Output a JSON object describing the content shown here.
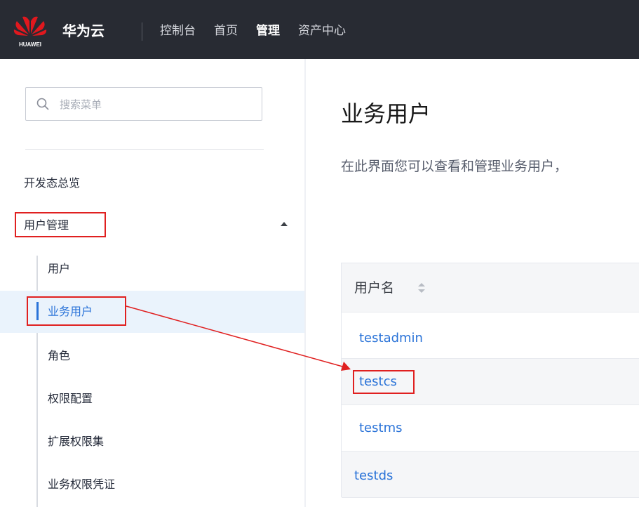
{
  "topbar": {
    "brand": "华为云",
    "logo_text": "HUAWEI",
    "nav": [
      {
        "label": "控制台",
        "active": false
      },
      {
        "label": "首页",
        "active": false
      },
      {
        "label": "管理",
        "active": true
      },
      {
        "label": "资产中心",
        "active": false
      }
    ]
  },
  "sidebar": {
    "search_placeholder": "搜索菜单",
    "overview": "开发态总览",
    "group": "用户管理",
    "sub_items": [
      {
        "label": "用户",
        "active": false
      },
      {
        "label": "业务用户",
        "active": true
      },
      {
        "label": "角色",
        "active": false
      },
      {
        "label": "权限配置",
        "active": false
      },
      {
        "label": "扩展权限集",
        "active": false
      },
      {
        "label": "业务权限凭证",
        "active": false
      }
    ]
  },
  "main": {
    "title": "业务用户",
    "description": "在此界面您可以查看和管理业务用户，",
    "table": {
      "column_header": "用户名",
      "rows": [
        "testadmin",
        "testcs",
        "testms",
        "testds"
      ]
    }
  },
  "colors": {
    "topbar_bg": "#282b33",
    "link": "#2a73d8",
    "highlight_box": "#e02020",
    "active_row_bg": "#eaf3fc"
  },
  "icons": [
    "huawei-logo",
    "search-icon",
    "caret-up-icon",
    "sort-icon"
  ]
}
